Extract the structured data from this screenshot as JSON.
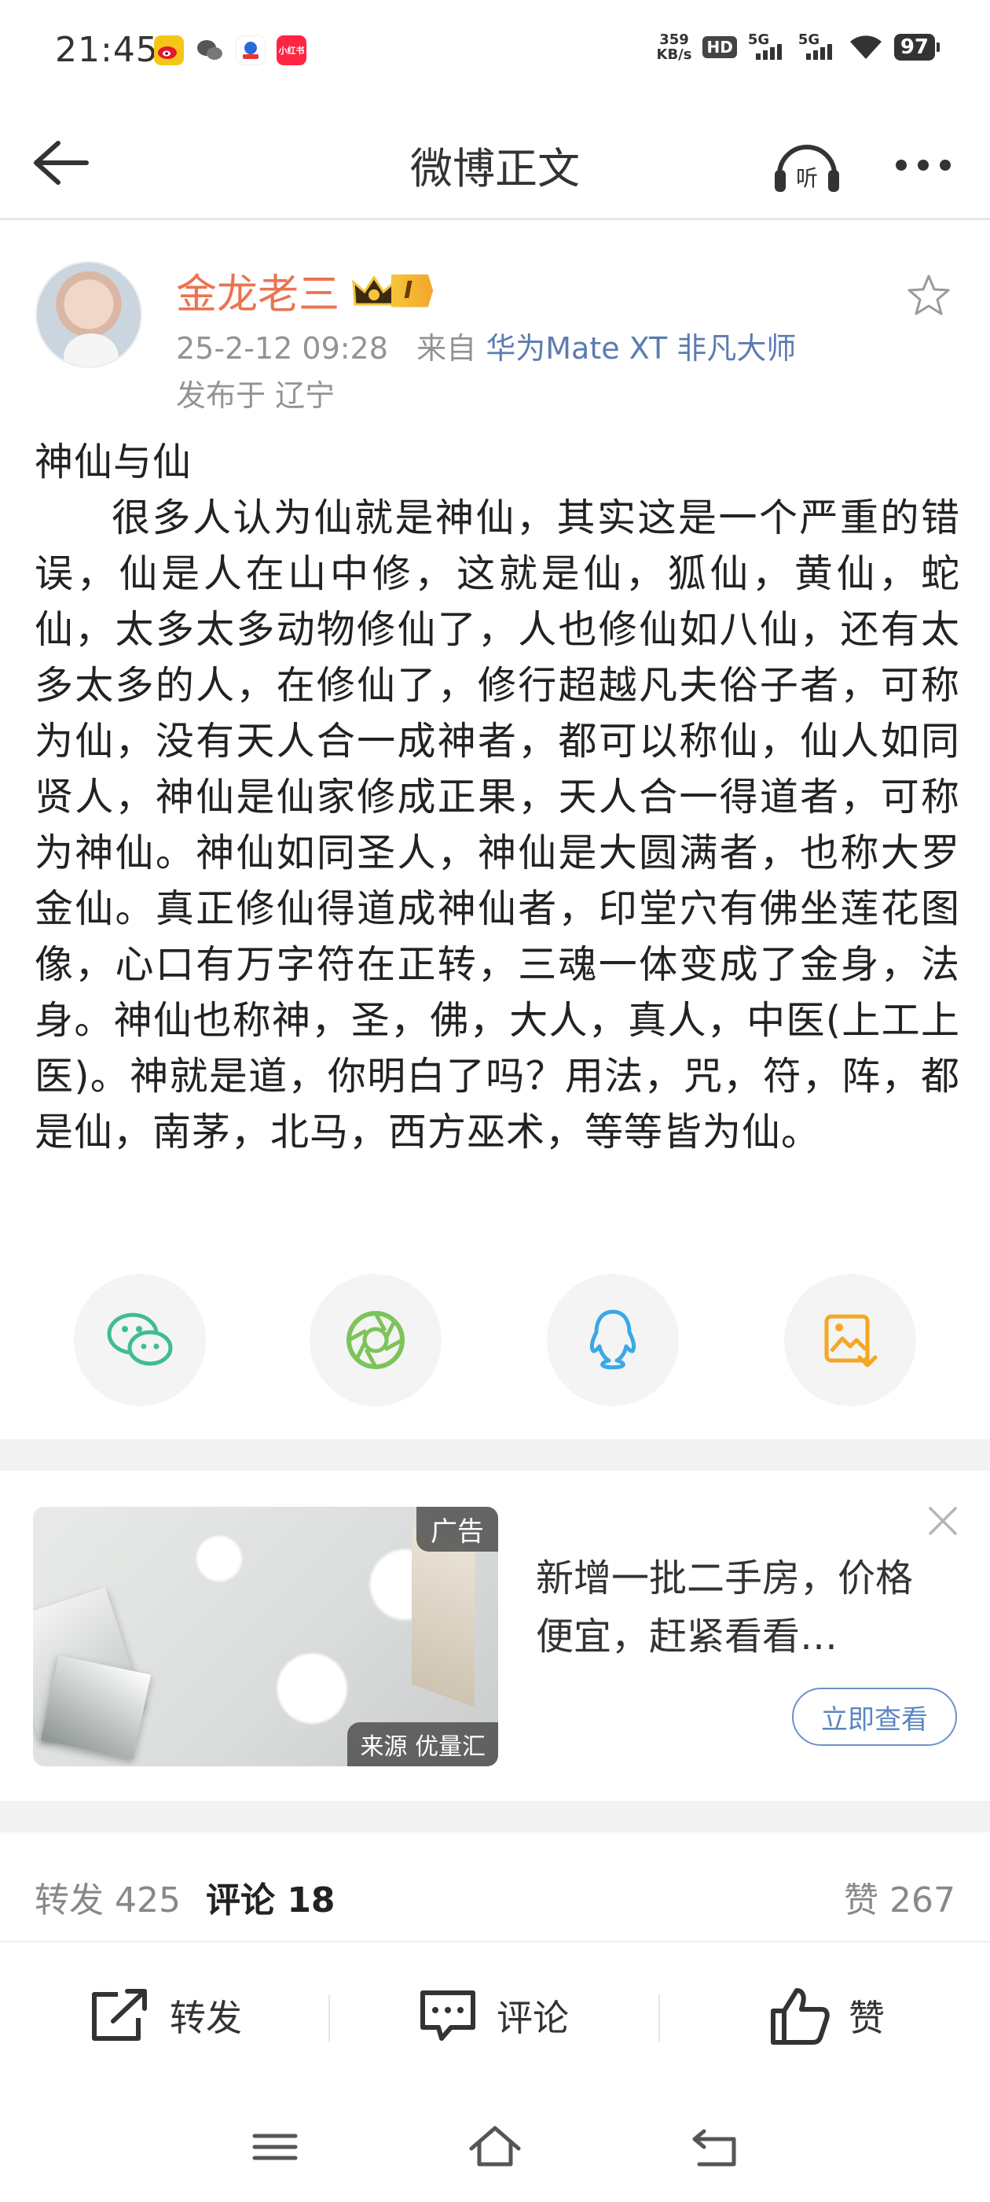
{
  "status_bar": {
    "time": "21:45",
    "net_speed_value": "359",
    "net_speed_unit": "KB/s",
    "hd_label": "HD",
    "signal_1": "5G",
    "signal_2": "5G",
    "battery": "97",
    "app_icons": [
      "weibo-icon",
      "wechat-icon",
      "app-icon",
      "xiaohongshu-icon"
    ],
    "xiaohongshu_label": "小红书"
  },
  "nav": {
    "title": "微博正文",
    "listen_label": "听"
  },
  "post": {
    "author": "金龙老三",
    "vip_level": "I",
    "date": "25-2-12 09:28",
    "source_prefix": "来自",
    "source_device": "华为Mate XT 非凡大师",
    "location": "发布于 辽宁",
    "title": "神仙与仙",
    "text": "很多人认为仙就是神仙，其实这是一个严重的错误，仙是人在山中修，这就是仙，狐仙，黄仙，蛇仙，太多太多动物修仙了，人也修仙如八仙，还有太多太多的人，在修仙了，修行超越凡夫俗子者，可称为仙，没有天人合一成神者，都可以称仙，仙人如同贤人，神仙是仙家修成正果，天人合一得道者，可称为神仙。神仙如同圣人，神仙是大圆满者，也称大罗金仙。真正修仙得道成神仙者，印堂穴有佛坐莲花图像，心口有万字符在正转，三魂一体变成了金身，法身。神仙也称神，圣，佛，大人，真人，中医(上工上医)。神就是道，你明白了吗？用法，咒，符，阵，都是仙，南茅，北马，西方巫术，等等皆为仙。"
  },
  "share": {
    "buttons": [
      "wechat-icon",
      "moments-icon",
      "qq-icon",
      "save-image-icon"
    ],
    "colors": {
      "wechat": "#3fbd8f",
      "moments": "#7cc45a",
      "qq": "#3aa8e6",
      "save": "#f5a623"
    }
  },
  "ad": {
    "tag": "广告",
    "source": "来源 优量汇",
    "title": "新增一批二手房，价格便宜，赶紧看看…",
    "cta": "立即查看"
  },
  "counts": {
    "repost": "转发 425",
    "comment": "评论 18",
    "like": "赞 267"
  },
  "actions": {
    "repost": "转发",
    "comment": "评论",
    "like": "赞"
  },
  "colors": {
    "author": "#eb7350",
    "link": "#5b7cb1",
    "meta": "#939393"
  }
}
